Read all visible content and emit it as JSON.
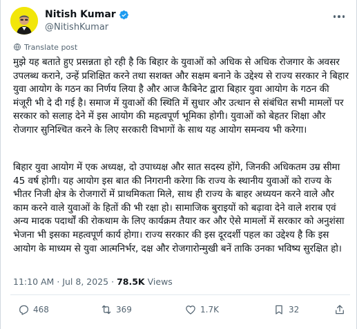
{
  "author": {
    "name": "Nitish Kumar",
    "handle": "@NitishKumar"
  },
  "translate_label": "Translate post",
  "post": {
    "paragraph1": "मुझे यह बताते हुए प्रसन्नता हो रही है कि बिहार के युवाओं को अधिक से अधिक रोजगार के अवसर उपलब्ध कराने, उन्हें प्रशिक्षित करने तथा सशक्त और सक्षम बनाने के उद्देश्य से राज्य सरकार ने बिहार युवा आयोग के गठन का निर्णय लिया है और आज कैबिनेट द्वारा बिहार युवा आयोग के गठन की मंजूरी भी दे दी गई है। समाज में युवाओं की स्थिति में सुधार और उत्थान से संबंधित सभी मामलों पर सरकार को सलाह देने में इस आयोग की महत्वपूर्ण भूमिका होगी। युवाओं को बेहतर शिक्षा और रोजगार सुनिश्चित करने के लिए सरकारी विभागों के साथ यह आयोग समन्वय भी करेगा।",
    "paragraph2": "बिहार युवा आयोग में एक अध्यक्ष, दो उपाध्यक्ष और सात सदस्य होंगे, जिनकी अधिकतम उम्र सीमा 45 वर्ष होगी। यह आयोग इस बात की निगरानी करेगा कि राज्य के स्थानीय युवाओं को राज्य के भीतर निजी क्षेत्र के रोजगारों में प्राथमिकता मिले, साथ ही राज्य के बाहर अध्ययन करने वाले और काम करने वाले युवाओं के हितों की भी रक्षा हो। सामाजिक बुराइयों को बढ़ावा देने वाले शराब एवं अन्य मादक पदार्थों की रोकथाम के लिए कार्यक्रम तैयार कर और ऐसे मामलों में सरकार को अनुशंसा भेजना भी इसका महत्वपूर्ण कार्य होगा। राज्य सरकार की इस दूरदर्शी पहल का उद्देश्य है कि इस आयोग के माध्यम से युवा आत्मनिर्भर, दक्ष और रोजगारोन्मुखी बनें ताकि उनका भविष्य सुरक्षित हो।"
  },
  "meta": {
    "time": "11:10 AM",
    "date": "Jul 8, 2025",
    "views": "78.5K",
    "views_label": "Views"
  },
  "actions": {
    "replies": "468",
    "reposts": "369",
    "likes": "1.7K",
    "bookmarks": "32"
  },
  "colors": {
    "avatar_bg": "#f2e60a",
    "verified": "#1d9bf0",
    "muted": "#536471"
  },
  "icons": [
    "verified-badge-icon",
    "more-icon",
    "globe-icon",
    "reply-icon",
    "repost-icon",
    "like-icon",
    "bookmark-icon",
    "share-icon"
  ]
}
